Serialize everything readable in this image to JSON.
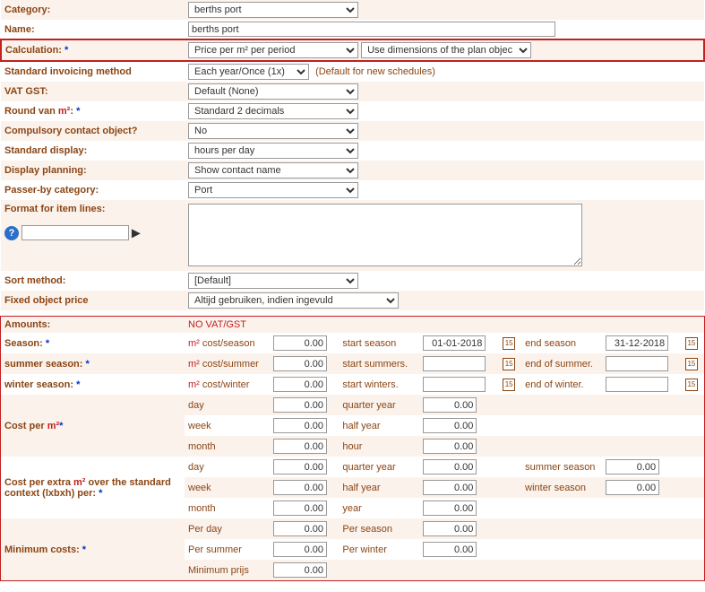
{
  "upper": {
    "category": {
      "label": "Category:",
      "value": "berths port"
    },
    "name": {
      "label": "Name:",
      "value": "berths port"
    },
    "calculation": {
      "label": "Calculation:",
      "ast": " *",
      "val1": "Price per m² per period",
      "val2": "Use dimensions of the plan objec"
    },
    "invoicing": {
      "label": "Standard invoicing method",
      "value": "Each year/Once (1x)",
      "note": "(Default for new schedules)"
    },
    "vat": {
      "label": "VAT GST:",
      "value": "Default (None)"
    },
    "round": {
      "label": "Round van ",
      "unit": "m²",
      ":": ": ",
      "ast": "*",
      "value": "Standard 2 decimals"
    },
    "compulsory": {
      "label": "Compulsory contact object?",
      "value": "No"
    },
    "stddisplay": {
      "label": "Standard display:",
      "value": "hours per day"
    },
    "dispplan": {
      "label": "Display planning:",
      "value": "Show contact name"
    },
    "passer": {
      "label": "Passer-by category:",
      "value": "Port"
    },
    "format": {
      "label": "Format for item lines:",
      "value": ""
    },
    "sort": {
      "label": "Sort method:",
      "value": "[Default]"
    },
    "fixed": {
      "label": "Fixed object price",
      "value": "Altijd gebruiken, indien ingevuld"
    }
  },
  "chart_data": {
    "type": "table",
    "title": "Amounts",
    "note": "NO VAT/GST",
    "season": {
      "main": {
        "label": "Season:",
        "unit": "m² cost/season",
        "cost": "0.00",
        "start_label": "start season",
        "start": "01-01-2018",
        "end_label": "end season",
        "end": "31-12-2018"
      },
      "summer": {
        "label": "summer season:",
        "unit": "m² cost/summer",
        "cost": "0.00",
        "start_label": "start summers.",
        "start": "",
        "end_label": "end of summer.",
        "end": ""
      },
      "winter": {
        "label": "winter season:",
        "unit": "m² cost/winter",
        "cost": "0.00",
        "start_label": "start winters.",
        "start": "",
        "end_label": "end of winter.",
        "end": ""
      }
    },
    "cost_per_m2": {
      "label": "Cost per m²",
      "rows": [
        {
          "a": "day",
          "av": "0.00",
          "b": "quarter year",
          "bv": "0.00"
        },
        {
          "a": "week",
          "av": "0.00",
          "b": "half year",
          "bv": "0.00"
        },
        {
          "a": "month",
          "av": "0.00",
          "b": "hour",
          "bv": "0.00"
        }
      ]
    },
    "cost_extra": {
      "label": "Cost per extra m² over the standard context (lxbxh) per:",
      "rows": [
        {
          "a": "day",
          "av": "0.00",
          "b": "quarter year",
          "bv": "0.00",
          "c": "summer season",
          "cv": "0.00"
        },
        {
          "a": "week",
          "av": "0.00",
          "b": "half year",
          "bv": "0.00",
          "c": "winter season",
          "cv": "0.00"
        },
        {
          "a": "month",
          "av": "0.00",
          "b": "year",
          "bv": "0.00"
        }
      ]
    },
    "minimum": {
      "label": "Minimum costs:",
      "rows": [
        {
          "a": "Per day",
          "av": "0.00",
          "b": "Per season",
          "bv": "0.00"
        },
        {
          "a": "Per summer",
          "av": "0.00",
          "b": "Per winter",
          "bv": "0.00"
        },
        {
          "a": "Minimum prijs",
          "av": "0.00"
        }
      ]
    }
  }
}
